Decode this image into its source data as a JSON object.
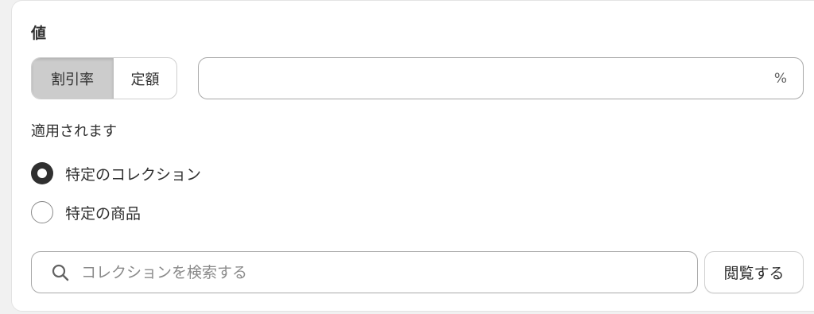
{
  "value_section": {
    "title": "値",
    "type_toggle": {
      "options": [
        {
          "label": "割引率",
          "selected": true
        },
        {
          "label": "定額",
          "selected": false
        }
      ]
    },
    "amount_field": {
      "value": "",
      "placeholder": "",
      "suffix": "%"
    }
  },
  "applies_to": {
    "label": "適用されます",
    "options": [
      {
        "label": "特定のコレクション",
        "checked": true
      },
      {
        "label": "特定の商品",
        "checked": false
      }
    ]
  },
  "search": {
    "placeholder": "コレクションを検索する",
    "value": "",
    "icon": "search-icon"
  },
  "browse_button": {
    "label": "閲覧する"
  },
  "colors": {
    "card_bg": "#ffffff",
    "page_bg": "#f1f1f1",
    "selected_segment_bg": "#cccccc",
    "text": "#303030",
    "radio_checked": "#303030"
  }
}
